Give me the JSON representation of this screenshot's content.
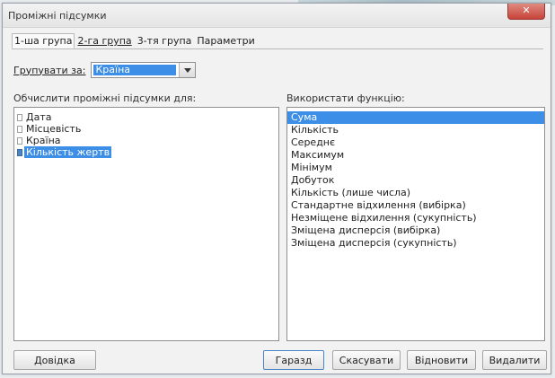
{
  "dialog": {
    "title": "Проміжні підсумки",
    "close_label": "✕"
  },
  "tabs": [
    {
      "label": "1-ша група",
      "active": true
    },
    {
      "label": "2-га група",
      "active": false
    },
    {
      "label": "3-тя група",
      "active": false
    },
    {
      "label": "Параметри",
      "active": false
    }
  ],
  "group_by": {
    "label": "Групувати за:",
    "value": "Країна"
  },
  "calc_for": {
    "label": "Обчислити проміжні підсумки для:",
    "items": [
      {
        "label": "Дата",
        "checked": false,
        "selected": false
      },
      {
        "label": "Місцевість",
        "checked": false,
        "selected": false
      },
      {
        "label": "Країна",
        "checked": false,
        "selected": false
      },
      {
        "label": "Кількість жертв",
        "checked": true,
        "selected": true
      }
    ]
  },
  "functions": {
    "label": "Використати функцію:",
    "items": [
      "Сума",
      "Кількість",
      "Середнє",
      "Максимум",
      "Мінімум",
      "Добуток",
      "Кількість (лише числа)",
      "Стандартне відхилення (вибірка)",
      "Незміщене відхилення (сукупність)",
      "Зміщена дисперсія (вибірка)",
      "Зміщена дисперсія (сукупність)"
    ],
    "selected_index": 0
  },
  "buttons": {
    "help": "Довідка",
    "ok": "Гаразд",
    "cancel": "Скасувати",
    "restore": "Відновити",
    "delete": "Видалити"
  },
  "colors": {
    "selection": "#3d8ee6",
    "close_button": "#c7443a"
  }
}
